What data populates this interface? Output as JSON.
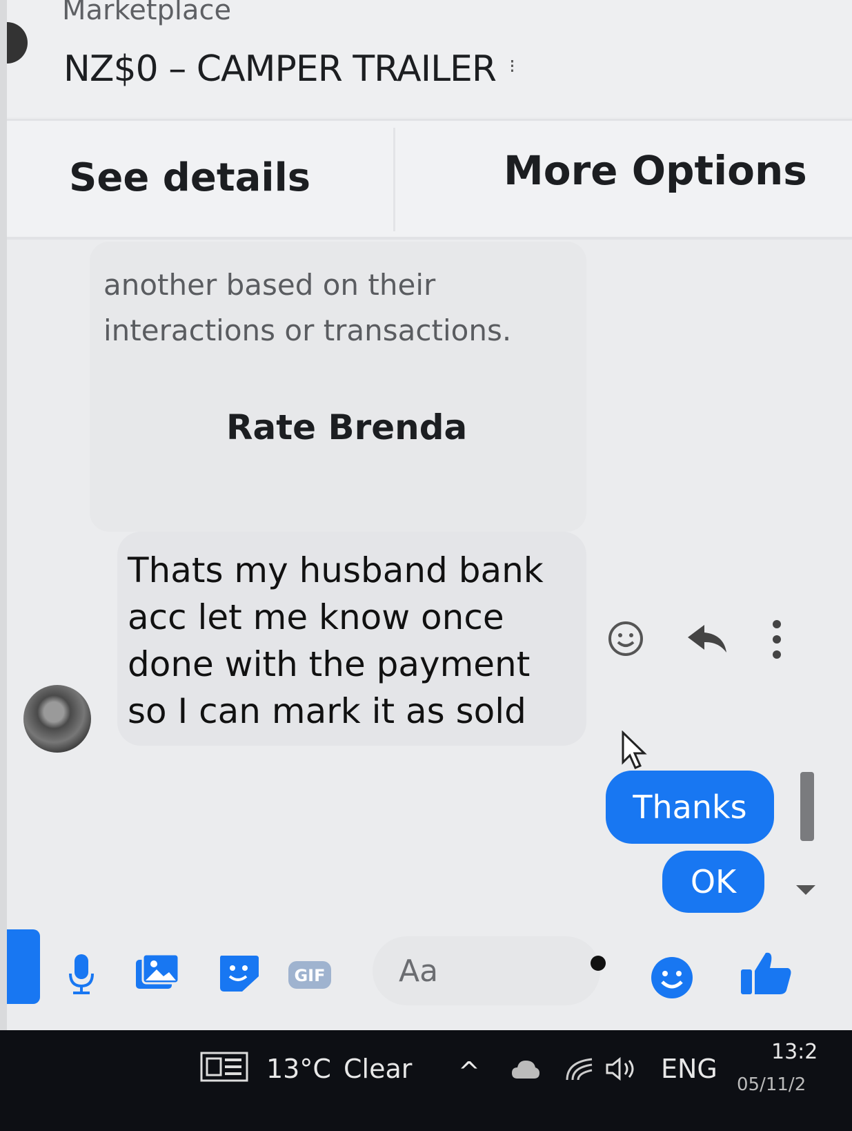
{
  "header": {
    "context": "Marketplace",
    "title": "NZ$0 – CAMPER TRAILER",
    "see_details": "See details",
    "more_options": "More Options"
  },
  "thread": {
    "notice_line1": "another based on their",
    "notice_line2": "interactions or transactions.",
    "rate_label": "Rate Brenda",
    "incoming": [
      "Thats my husband bank",
      "acc let me know once",
      "done with the payment",
      "so I can mark it as sold"
    ],
    "outgoing": [
      "Thanks",
      "OK"
    ]
  },
  "composer": {
    "placeholder": "Aa",
    "gif_label": "GIF",
    "icons": [
      "mic-icon",
      "image-icon",
      "sticker-icon",
      "gif-icon",
      "emoji-icon",
      "like-icon"
    ]
  },
  "taskbar": {
    "temperature": "13°C",
    "weather": "Clear",
    "language": "ENG",
    "time": "13:2",
    "date": "05/11/2"
  },
  "colors": {
    "accent": "#1877f2",
    "background": "#ebecee",
    "taskbar": "#0d0f14"
  }
}
